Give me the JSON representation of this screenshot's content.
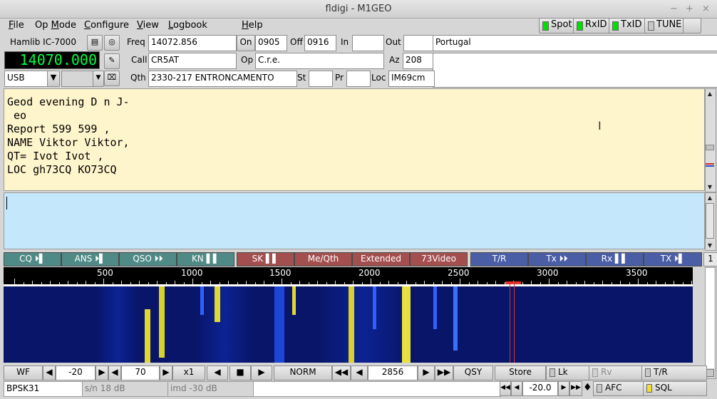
{
  "window": {
    "title": "fldigi - M1GEO",
    "min": "−",
    "max": "+",
    "close": "×"
  },
  "menu": [
    {
      "pre": "",
      "u": "F",
      "post": "ile"
    },
    {
      "pre": "Op ",
      "u": "M",
      "post": "ode"
    },
    {
      "pre": "",
      "u": "C",
      "post": "onfigure"
    },
    {
      "pre": "",
      "u": "V",
      "post": "iew"
    },
    {
      "pre": "",
      "u": "L",
      "post": "ogbook"
    },
    {
      "pre": "",
      "u": "H",
      "post": "elp"
    }
  ],
  "toggles": {
    "spot": "Spot",
    "rxid": "RxID",
    "txid": "TxID",
    "tune": "TUNE"
  },
  "colors": {
    "led_on": "#00e000",
    "led_off": "#c8c8c8",
    "rx_bg": "#fff5cc",
    "tx_bg": "#c4e7fb",
    "freq_display": "#00ff40"
  },
  "rig": {
    "name": "Hamlib IC-7000",
    "freq_display": "14070.000",
    "mode": "USB",
    "bandwidth": ""
  },
  "log": {
    "freq_label": "Freq",
    "freq": "14072.856",
    "on_label": "On",
    "on": "0905",
    "off_label": "Off",
    "off": "0916",
    "in_label": "In",
    "in": "",
    "out_label": "Out",
    "out": "",
    "country": "Portugal",
    "call_label": "Call",
    "call": "CR5AT",
    "op_label": "Op",
    "op": "C.r.e.",
    "az_label": "Az",
    "az": "208",
    "qth_label": "Qth",
    "qth": "2330-217 ENTRONCAMENTO",
    "st_label": "St",
    "st": "",
    "pr_label": "Pr",
    "pr": "",
    "loc_label": "Loc",
    "loc": "IM69cm",
    "notes": ""
  },
  "rx_text": [
    "Geod evening D n J-",
    " eo",
    "Report 599 599 ,",
    "NAME Viktor Viktor,",
    "QT= Ivot Ivot ,",
    "LOC gh73CQ KO73CQ"
  ],
  "macros": [
    "CQ ⏵▌",
    "ANS ⏵▌",
    "QSO ⏵⏵",
    "KN ▌▌",
    "SK ▌▌",
    "Me/Qth",
    "Extended",
    "73Video",
    "T/R",
    "Tx ⏵⏵",
    "Rx ▌▌",
    "TX ⏵▌"
  ],
  "macro_page": "1",
  "scale_labels": [
    "500",
    "1000",
    "1500",
    "2000",
    "2500",
    "3000",
    "3500"
  ],
  "waterfall": {
    "wf_button": "WF",
    "ref": "-20",
    "range": "70",
    "zoom": "x1",
    "norm": "NORM",
    "carrier": "2856",
    "qsy": "QSY",
    "store": "Store",
    "lk": "Lk",
    "rv": "Rv",
    "tr": "T/R"
  },
  "status": {
    "mode": "BPSK31",
    "sn": "s/n 18 dB",
    "imd": "imd -30 dB",
    "squelch": "-20.0",
    "afc": "AFC",
    "sql": "SQL"
  }
}
